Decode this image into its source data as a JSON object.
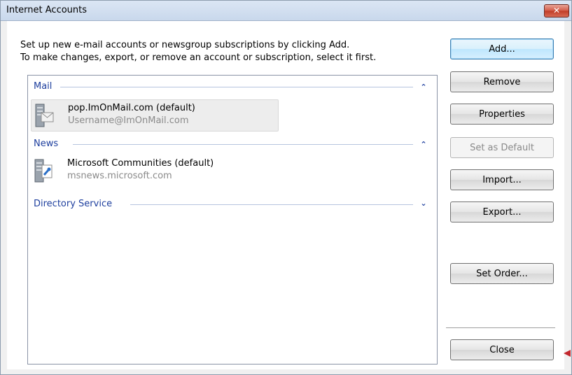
{
  "window": {
    "title": "Internet Accounts",
    "close_glyph": "✕"
  },
  "intro": {
    "line1": "Set up new e-mail accounts or newsgroup subscriptions by clicking Add.",
    "line2": "To make changes, export, or remove an account or subscription, select it first."
  },
  "groups": {
    "mail": {
      "label": "Mail",
      "expanded": true,
      "accounts": [
        {
          "name": "pop.ImOnMail.com (default)",
          "detail": "Username@ImOnMail.com",
          "icon": "mail-server-icon",
          "selected": true
        }
      ]
    },
    "news": {
      "label": "News",
      "expanded": true,
      "accounts": [
        {
          "name": "Microsoft Communities (default)",
          "detail": "msnews.microsoft.com",
          "icon": "news-server-icon",
          "selected": false
        }
      ]
    },
    "directory": {
      "label": "Directory Service",
      "expanded": false
    }
  },
  "buttons": {
    "add": "Add...",
    "remove": "Remove",
    "properties": "Properties",
    "set_default": "Set as Default",
    "import": "Import...",
    "export": "Export...",
    "set_order": "Set Order...",
    "close": "Close"
  },
  "colors": {
    "group_header": "#1e3f9e",
    "title_bar": "#c9d8ec",
    "close_button": "#c03b26",
    "pointer_arrow": "#c2272d"
  }
}
